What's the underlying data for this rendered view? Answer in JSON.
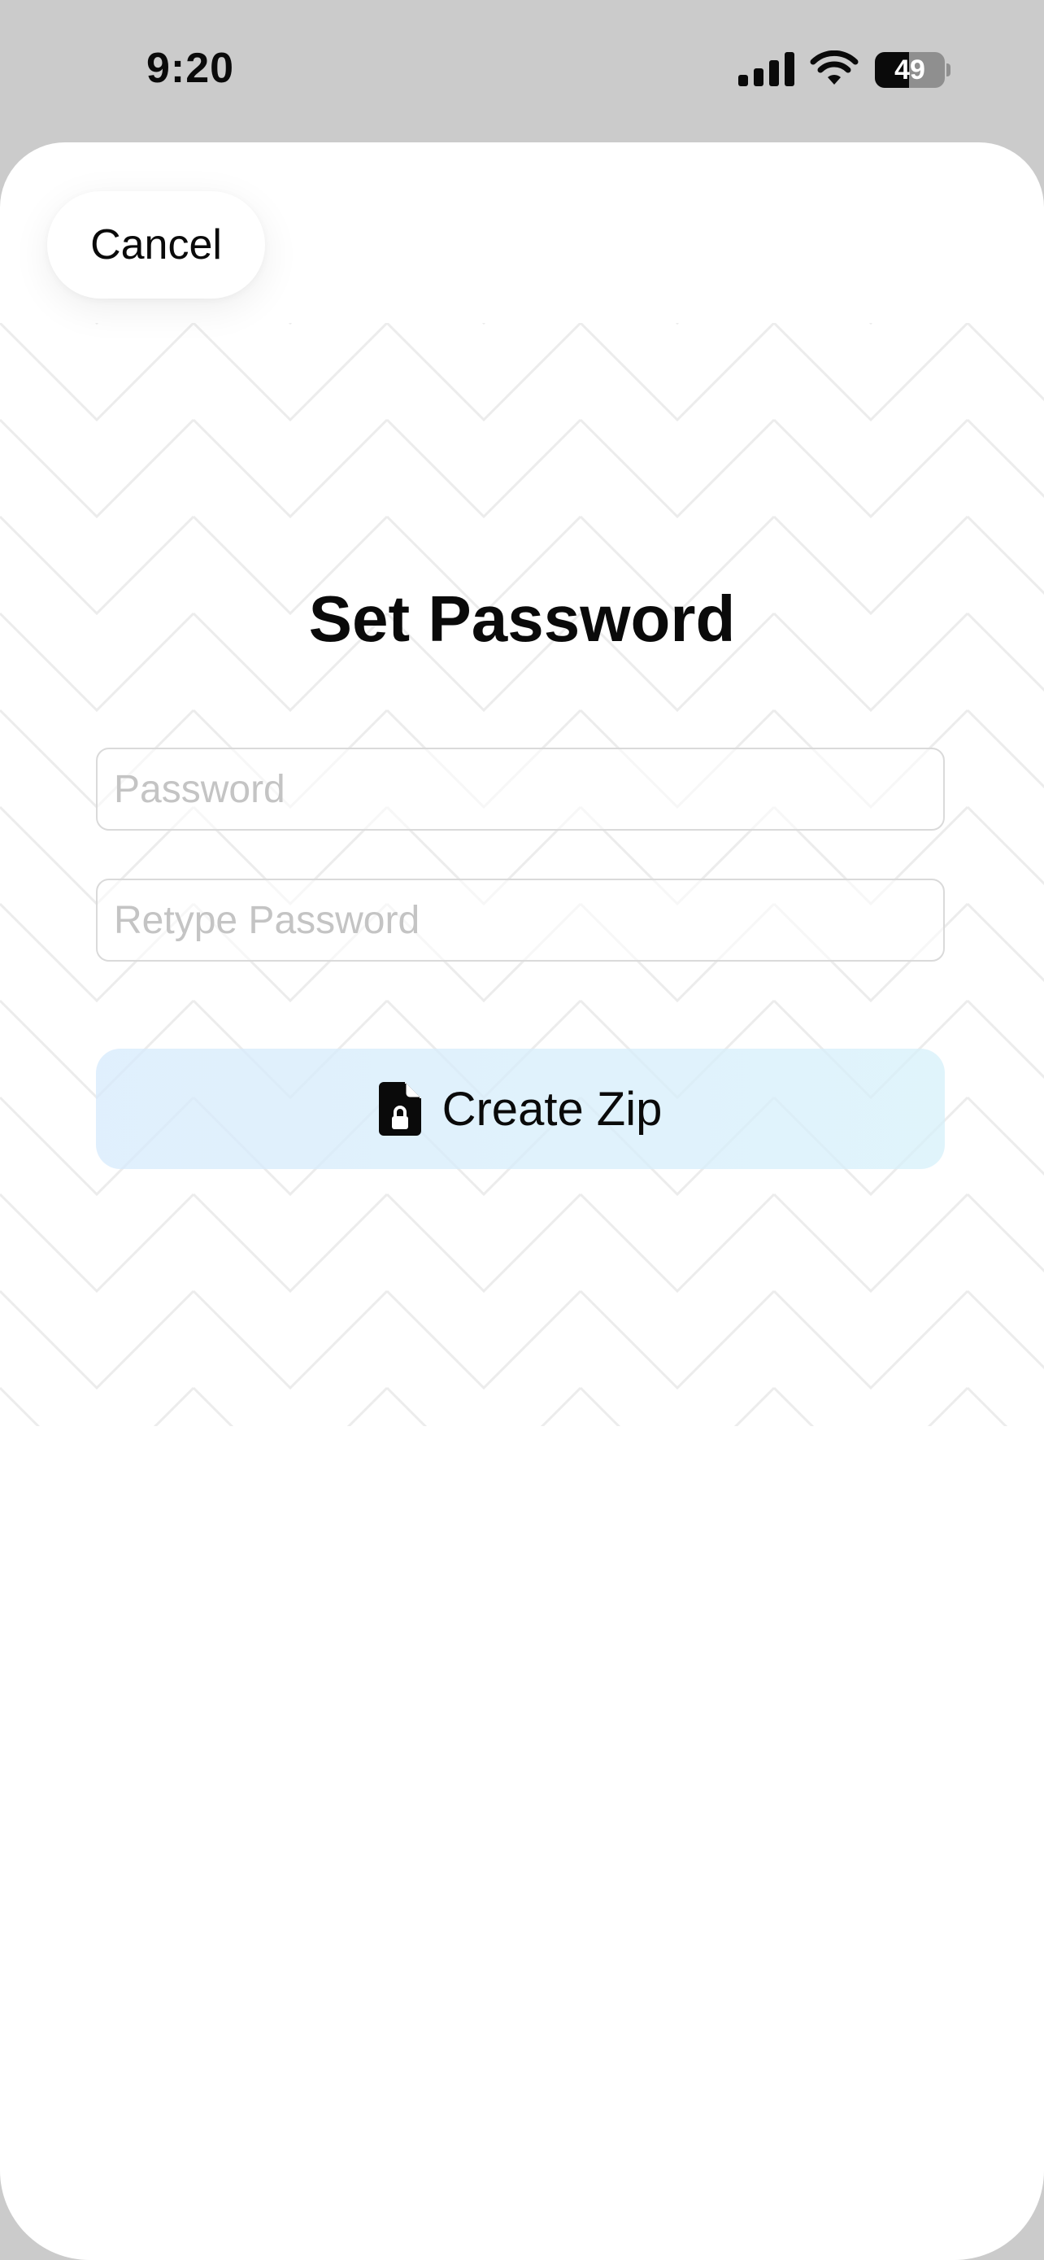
{
  "status_bar": {
    "time": "9:20",
    "battery_level": "49",
    "battery_fraction": 0.49,
    "icons": [
      "cellular-signal-icon",
      "wifi-icon",
      "battery-icon"
    ]
  },
  "sheet": {
    "cancel_label": "Cancel",
    "title": "Set Password",
    "password_placeholder": "Password",
    "retype_placeholder": "Retype Password",
    "password_value": "",
    "retype_value": "",
    "create_label": "Create Zip",
    "create_icon": "lock-file-icon"
  },
  "colors": {
    "status_background": "#cbcbcb",
    "sheet_background": "#ffffff",
    "button_tint": "#d6eafc",
    "placeholder": "#c4c4c4"
  }
}
